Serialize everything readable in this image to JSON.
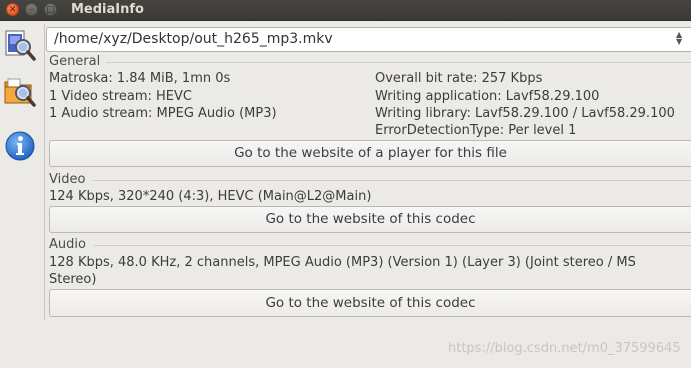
{
  "window": {
    "title": "MediaInfo"
  },
  "file_select": {
    "value": "/home/xyz/Desktop/out_h265_mp3.mkv"
  },
  "general": {
    "label": "General",
    "left": [
      "Matroska: 1.84 MiB, 1mn 0s",
      "1 Video stream: HEVC",
      "1 Audio stream: MPEG Audio (MP3)"
    ],
    "right": [
      "Overall bit rate: 257 Kbps",
      "Writing application: Lavf58.29.100",
      "Writing library: Lavf58.29.100 / Lavf58.29.100",
      "ErrorDetectionType: Per level 1"
    ],
    "button": "Go to the website of a player for this file"
  },
  "video": {
    "label": "Video",
    "info": "124 Kbps, 320*240 (4:3), HEVC (Main@L2@Main)",
    "button": "Go to the website of this codec"
  },
  "audio": {
    "label": "Audio",
    "info_line1": "128 Kbps, 48.0 KHz, 2 channels, MPEG Audio (MP3) (Version 1) (Layer 3) (Joint stereo / MS",
    "info_line2": "Stereo)",
    "button": "Go to the website of this codec"
  },
  "toolbar": {
    "icons": [
      "open-file-icon",
      "open-folder-icon",
      "about-icon"
    ]
  },
  "watermark": "https://blog.csdn.net/m0_37599645"
}
